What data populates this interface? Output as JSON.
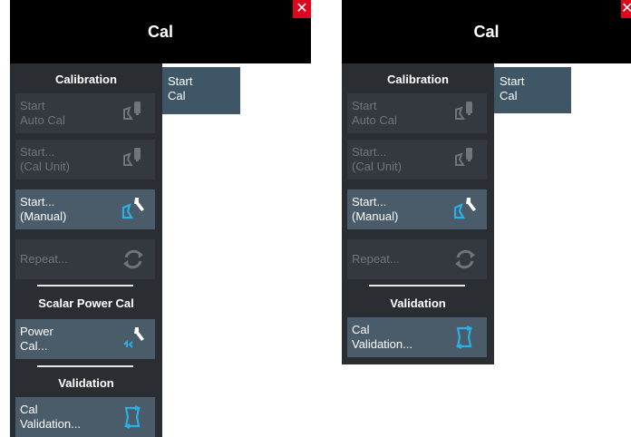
{
  "left": {
    "title": "Cal",
    "close": "✕",
    "tab": "Start\nCal",
    "calibration_header": "Calibration",
    "buttons": {
      "auto_cal": "Start\nAuto Cal",
      "cal_unit": "Start...\n(Cal Unit)",
      "manual": "Start...\n(Manual)",
      "repeat": "Repeat..."
    },
    "scalar_header": "Scalar Power Cal",
    "power_cal": "Power\nCal...",
    "validation_header": "Validation",
    "cal_validation": "Cal\nValidation..."
  },
  "right": {
    "title": "Cal",
    "close": "✕",
    "tab": "Start\nCal",
    "calibration_header": "Calibration",
    "buttons": {
      "auto_cal": "Start\nAuto Cal",
      "cal_unit": "Start...\n(Cal Unit)",
      "manual": "Start...\n(Manual)",
      "repeat": "Repeat..."
    },
    "validation_header": "Validation",
    "cal_validation": "Cal\nValidation..."
  },
  "colors": {
    "accent": "#2ab0e6",
    "close": "#e0061e",
    "enabled_button": "#4a5b69",
    "disabled_button": "#34393f"
  },
  "icons": {
    "auto_cal": "cal-unit-icon",
    "cal_unit": "cal-unit-icon",
    "manual": "wrench-port-icon",
    "repeat": "refresh-icon",
    "power_cal": "power-cal-icon",
    "cal_validation": "validation-icon"
  }
}
